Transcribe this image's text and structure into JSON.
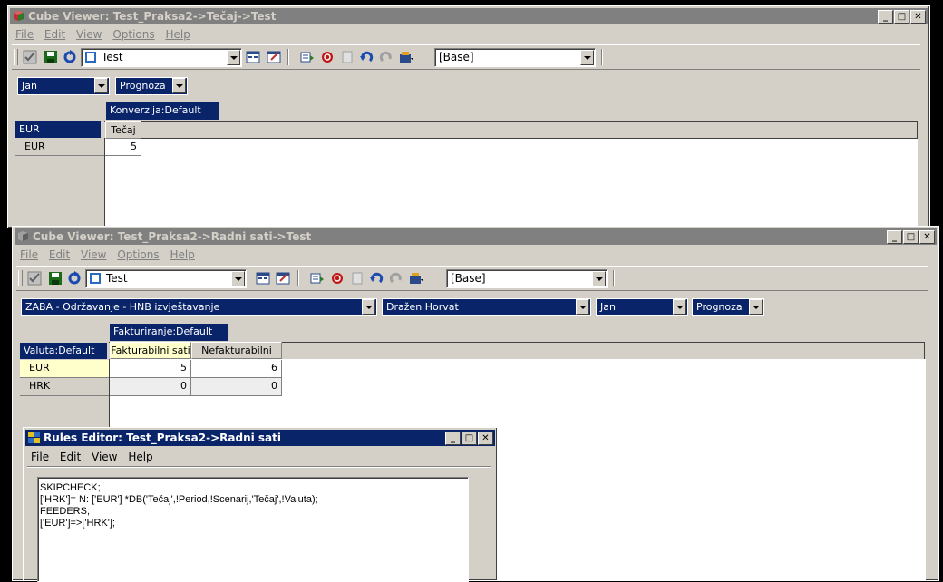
{
  "window1": {
    "title": "Cube Viewer: Test_Praksa2->Tečaj->Test",
    "menu": [
      "File",
      "Edit",
      "View",
      "Options",
      "Help"
    ],
    "view_combo": "Test",
    "subset_combo": "[Base]",
    "titles": [
      "Jan",
      "Prognoza"
    ],
    "column_dim": "Konverzija:Default",
    "row_dim": "EUR",
    "columns": [
      "Tečaj"
    ],
    "rows": [
      {
        "label": "EUR",
        "values": [
          "5"
        ]
      }
    ]
  },
  "window2": {
    "title": "Cube Viewer: Test_Praksa2->Radni sati->Test",
    "menu": [
      "File",
      "Edit",
      "View",
      "Options",
      "Help"
    ],
    "view_combo": "Test",
    "subset_combo": "[Base]",
    "titles": [
      "ZABA - Održavanje - HNB izvještavanje",
      "Dražen Horvat",
      "Jan",
      "Prognoza"
    ],
    "column_dim": "Fakturiranje:Default",
    "row_dim": "Valuta:Default",
    "columns": [
      "Fakturabilni sati",
      "Nefakturabilni sati"
    ],
    "rows": [
      {
        "label": "EUR",
        "values": [
          "5",
          "6"
        ]
      },
      {
        "label": "HRK",
        "values": [
          "0",
          "0"
        ]
      }
    ]
  },
  "rules_editor": {
    "title": "Rules Editor:  Test_Praksa2->Radni sati",
    "menu": [
      "File",
      "Edit",
      "View",
      "Help"
    ],
    "lines": [
      "SKIPCHECK;",
      "['HRK']= N: ['EUR'] *DB('Tečaj',!Period,!Scenarij,'Tečaj',!Valuta);",
      "FEEDERS;",
      "['EUR']=>['HRK'];"
    ]
  },
  "colors": {
    "title_active": "#0a246a",
    "title_inactive": "#808080",
    "face": "#d4d0c8",
    "selected_row": "#ffffcc"
  }
}
